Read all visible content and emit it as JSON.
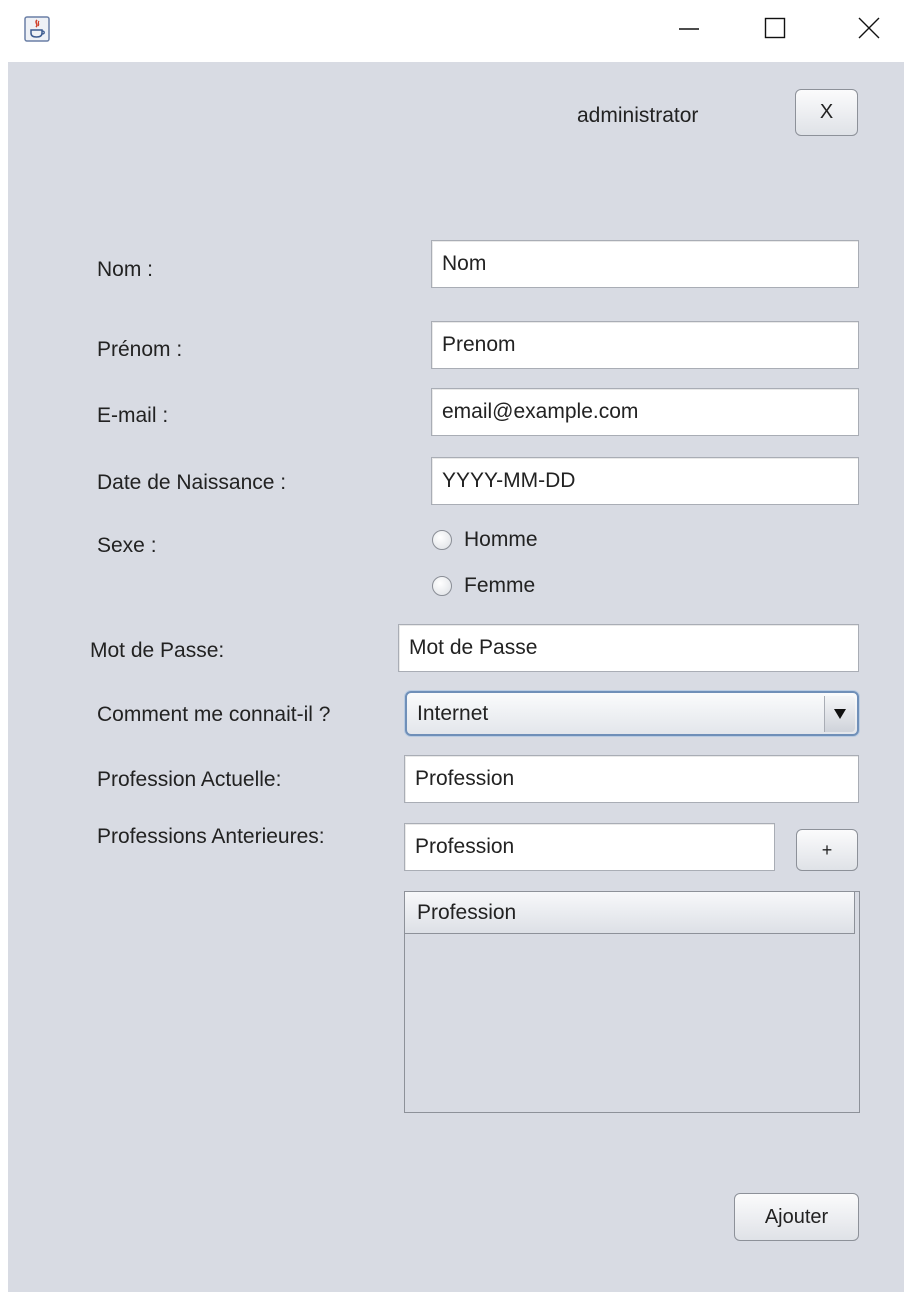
{
  "window": {
    "title": "",
    "min_icon": "minimize-icon",
    "max_icon": "maximize-icon",
    "close_icon": "close-icon"
  },
  "header": {
    "user_label": "administrator",
    "close_button_label": "X"
  },
  "form": {
    "nom": {
      "label": "Nom :",
      "value": "Nom"
    },
    "prenom": {
      "label": "Prénom :",
      "value": "Prenom"
    },
    "email": {
      "label": "E-mail :",
      "value": "email@example.com"
    },
    "date_naissance": {
      "label": "Date de Naissance :",
      "value": "YYYY-MM-DD"
    },
    "sexe": {
      "label": "Sexe :",
      "options": [
        "Homme",
        "Femme"
      ]
    },
    "mot_de_passe": {
      "label": "Mot de Passe:",
      "value": "Mot de Passe"
    },
    "comment_connait": {
      "label": "Comment me connait-il ?",
      "selected": "Internet"
    },
    "profession_actuelle": {
      "label": "Profession Actuelle:",
      "value": "Profession"
    },
    "professions_anterieures": {
      "label": "Professions Anterieures:",
      "value": "Profession",
      "add_button_label": "+"
    },
    "table": {
      "column_header": "Profession",
      "rows": []
    },
    "submit_label": "Ajouter"
  }
}
